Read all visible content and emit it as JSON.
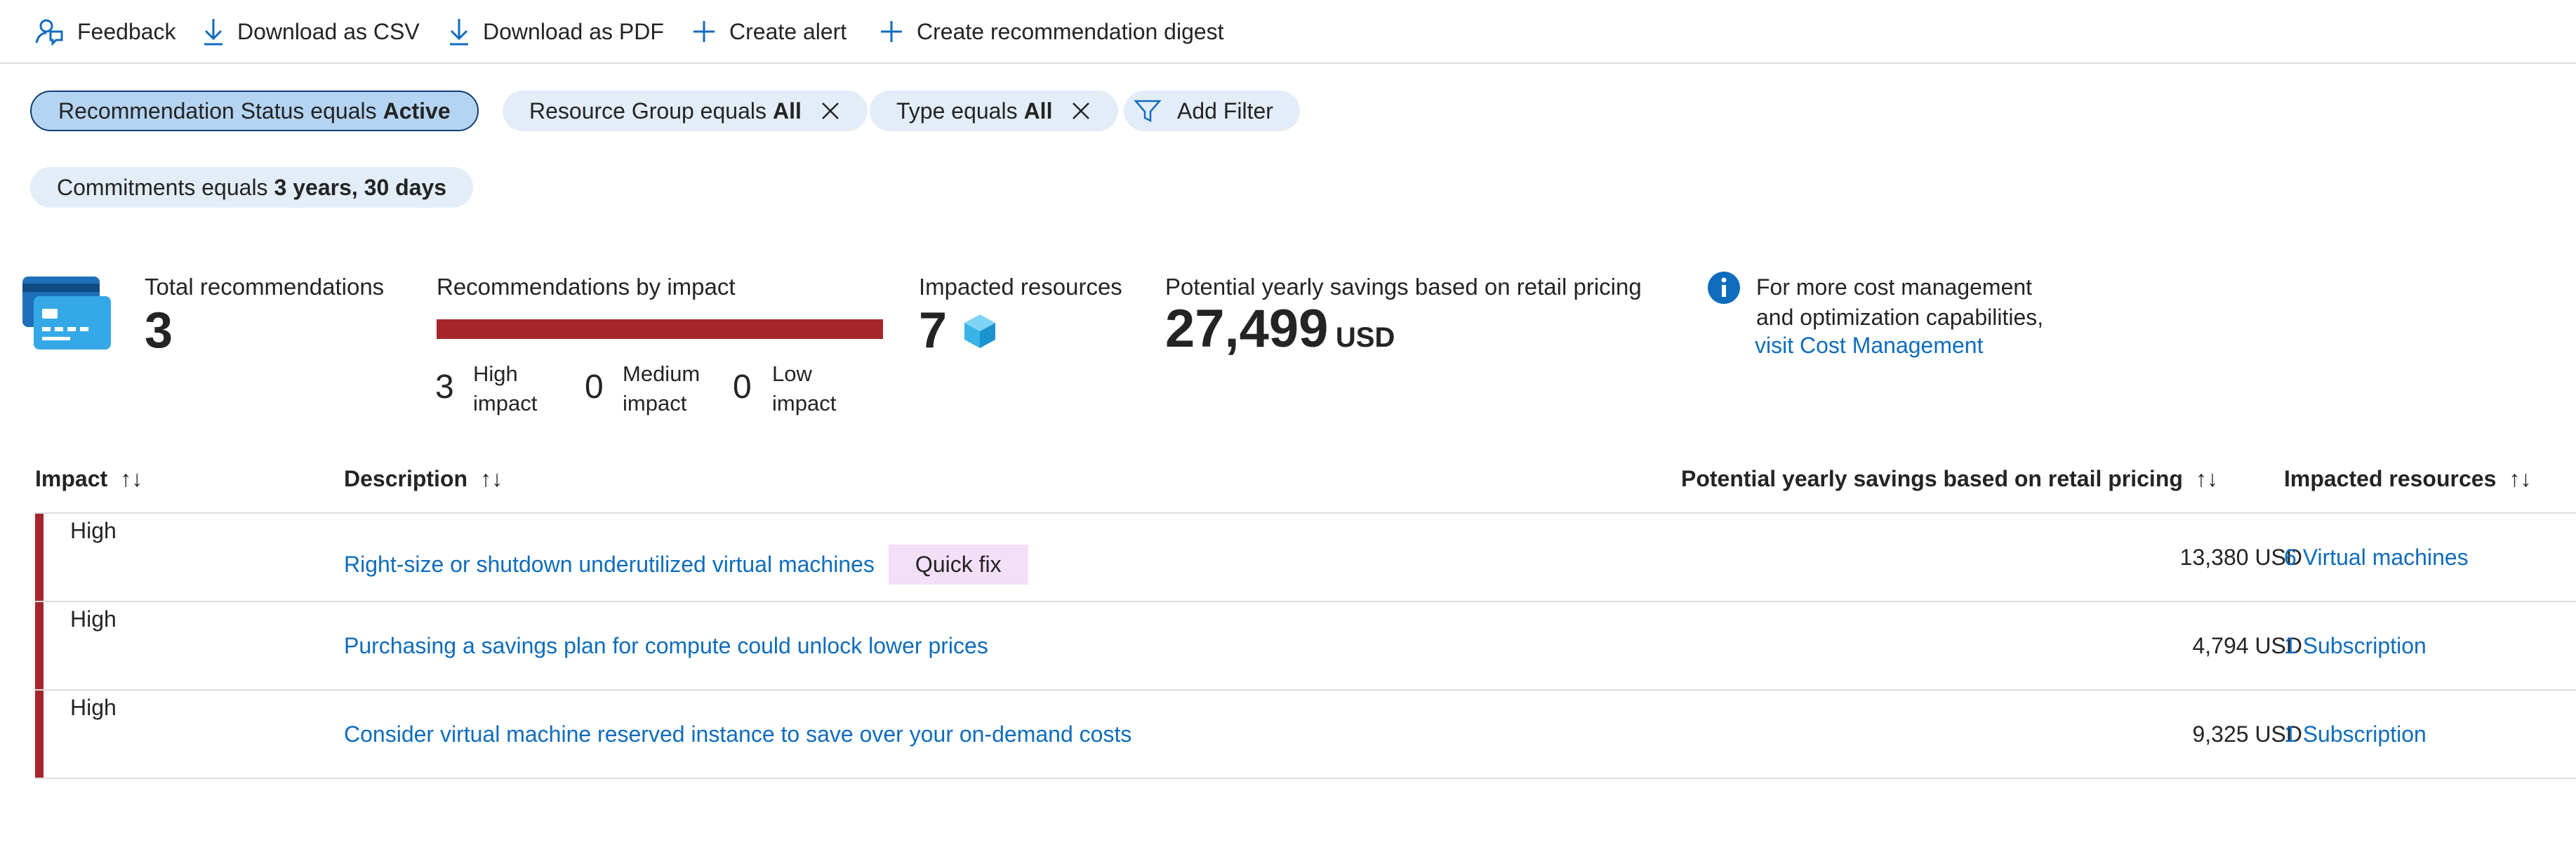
{
  "toolbar": {
    "feedback": "Feedback",
    "download_csv": "Download as CSV",
    "download_pdf": "Download as PDF",
    "create_alert": "Create alert",
    "create_digest": "Create recommendation digest"
  },
  "filters": [
    {
      "prefix": "Recommendation Status equals",
      "value": "Active",
      "active": true,
      "removable": false
    },
    {
      "prefix": "Resource Group equals",
      "value": "All",
      "active": false,
      "removable": true
    },
    {
      "prefix": "Type equals",
      "value": "All",
      "active": false,
      "removable": true
    },
    {
      "prefix": "Commitments equals",
      "value": "3 years, 30 days",
      "active": false,
      "removable": false
    }
  ],
  "add_filter": "Add Filter",
  "summary": {
    "total_label": "Total recommendations",
    "total_value": "3",
    "by_impact_label": "Recommendations by impact",
    "high_count": "3",
    "high_label_1": "High",
    "high_label_2": "impact",
    "medium_count": "0",
    "medium_label_1": "Medium",
    "medium_label_2": "impact",
    "low_count": "0",
    "low_label_1": "Low",
    "low_label_2": "impact",
    "impacted_label": "Impacted resources",
    "impacted_value": "7",
    "savings_label": "Potential yearly savings based on retail pricing",
    "savings_value": "27,499",
    "savings_unit": "USD",
    "info_line1": "For more cost management",
    "info_line2": "and optimization capabilities,",
    "info_link": "visit Cost Management"
  },
  "table": {
    "columns": {
      "impact": "Impact",
      "description": "Description",
      "savings": "Potential yearly savings based on retail pricing",
      "resources": "Impacted resources"
    },
    "rows": [
      {
        "impact": "High",
        "description": "Right-size or shutdown underutilized virtual machines",
        "badge": "Quick fix",
        "savings": "13,380 USD",
        "resources": "6 Virtual machines"
      },
      {
        "impact": "High",
        "description": "Purchasing a savings plan for compute could unlock lower prices",
        "badge": "",
        "savings": "4,794 USD",
        "resources": "1 Subscription"
      },
      {
        "impact": "High",
        "description": "Consider virtual machine reserved instance to save over your on-demand costs",
        "badge": "",
        "savings": "9,325 USD",
        "resources": "1 Subscription"
      }
    ]
  },
  "colors": {
    "accent_link": "#0f6cbd",
    "high_impact": "#a4262c",
    "active_pill": "#b4d4f2",
    "pill": "#e3edf7",
    "badge": "#f4dff9"
  }
}
